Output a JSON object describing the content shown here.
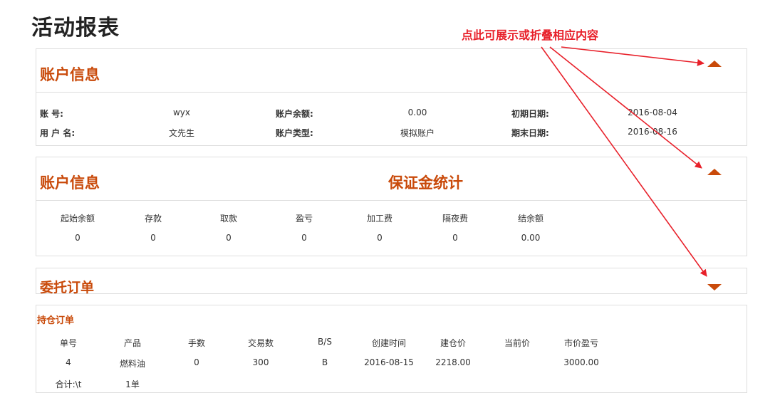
{
  "page": {
    "title": "活动报表",
    "annotation": "点此可展示或折叠相应内容"
  },
  "account_info": {
    "title": "账户信息",
    "fields": [
      {
        "label": "账 号:",
        "value": "wyx"
      },
      {
        "label": "账户余额:",
        "value": "0.00"
      },
      {
        "label": "初期日期:",
        "value": "2016-08-04"
      },
      {
        "label": "用 户 名:",
        "value": "文先生"
      },
      {
        "label": "账户类型:",
        "value": "模拟账户"
      },
      {
        "label": "期末日期:",
        "value": "2016-08-16"
      }
    ]
  },
  "margin_stats": {
    "title": "账户信息",
    "subtitle": "保证金统计",
    "headers": [
      "起始余额",
      "存款",
      "取款",
      "盈亏",
      "加工费",
      "隔夜费",
      "结余额"
    ],
    "values": [
      "0",
      "0",
      "0",
      "0",
      "0",
      "0",
      "0.00"
    ]
  },
  "orders": {
    "title": "委托订单"
  },
  "positions": {
    "title": "持仓订单",
    "headers": [
      "单号",
      "产品",
      "手数",
      "交易数",
      "B/S",
      "创建时间",
      "建仓价",
      "当前价",
      "市价盈亏"
    ],
    "row": [
      "4",
      "燃料油",
      "0",
      "300",
      "B",
      "2016-08-15",
      "2218.00",
      "",
      "3000.00"
    ],
    "total_label": "合计:\\t",
    "total_value": "1单"
  },
  "colors": {
    "accent": "#c94a0a",
    "annotation": "#e8202a",
    "border": "#dedede"
  }
}
